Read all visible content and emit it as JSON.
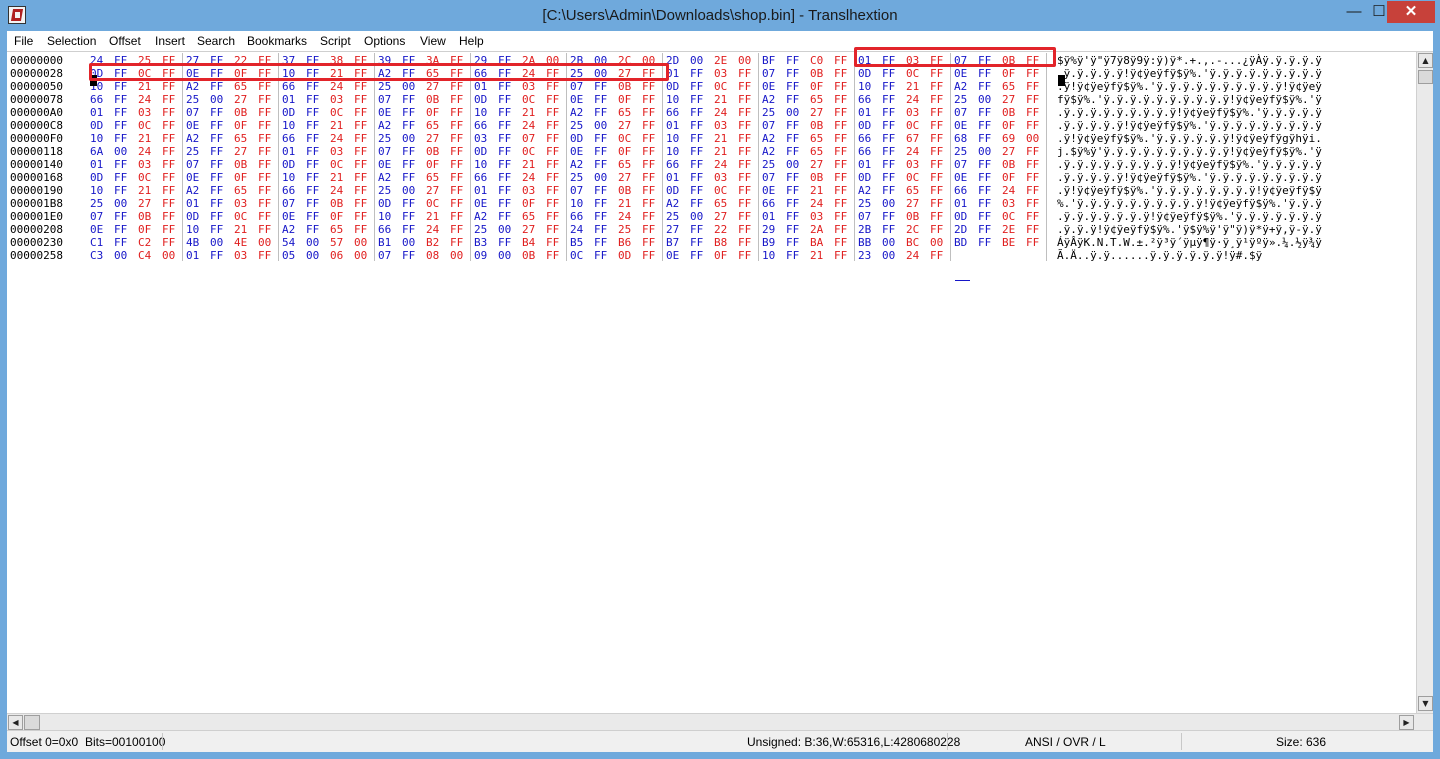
{
  "window": {
    "title": "[C:\\Users\\Admin\\Downloads\\shop.bin] - Translhextion",
    "min_glyph": "—",
    "max_glyph": "☐",
    "close_glyph": "✕"
  },
  "menu": [
    "File",
    "Selection",
    "Offset",
    "Insert",
    "Search",
    "Bookmarks",
    "Script",
    "Options",
    "View",
    "Help"
  ],
  "colors": {
    "red": "#e01e1e",
    "blue": "#1616c8",
    "highlight": "#e2242a"
  },
  "hex_rows": [
    {
      "offset": "00000000",
      "bytes": [
        "24",
        "FF",
        "25",
        "FF",
        "27",
        "FF",
        "22",
        "FF",
        "37",
        "FF",
        "38",
        "FF",
        "39",
        "FF",
        "3A",
        "FF",
        "29",
        "FF",
        "2A",
        "00",
        "2B",
        "00",
        "2C",
        "00",
        "2D",
        "00",
        "2E",
        "00",
        "BF",
        "FF",
        "C0",
        "FF",
        "01",
        "FF",
        "03",
        "FF",
        "07",
        "FF",
        "0B",
        "FF"
      ],
      "text": "$ÿ%ÿ'ÿ\"ÿ7ÿ8ÿ9ÿ:ÿ)ÿ*.+.,.-...¿ÿÀÿ.ÿ.ÿ.ÿ.ÿ"
    },
    {
      "offset": "00000028",
      "bytes": [
        "0D",
        "FF",
        "0C",
        "FF",
        "0E",
        "FF",
        "0F",
        "FF",
        "10",
        "FF",
        "21",
        "FF",
        "A2",
        "FF",
        "65",
        "FF",
        "66",
        "FF",
        "24",
        "FF",
        "25",
        "00",
        "27",
        "FF",
        "01",
        "FF",
        "03",
        "FF",
        "07",
        "FF",
        "0B",
        "FF",
        "0D",
        "FF",
        "0C",
        "FF",
        "0E",
        "FF",
        "0F",
        "FF"
      ],
      "text": ".ÿ.ÿ.ÿ.ÿ.ÿ!ÿ¢ÿeÿfÿ$ÿ%.'ÿ.ÿ.ÿ.ÿ.ÿ.ÿ.ÿ.ÿ.ÿ"
    },
    {
      "offset": "00000050",
      "bytes": [
        "10",
        "FF",
        "21",
        "FF",
        "A2",
        "FF",
        "65",
        "FF",
        "66",
        "FF",
        "24",
        "FF",
        "25",
        "00",
        "27",
        "FF",
        "01",
        "FF",
        "03",
        "FF",
        "07",
        "FF",
        "0B",
        "FF",
        "0D",
        "FF",
        "0C",
        "FF",
        "0E",
        "FF",
        "0F",
        "FF",
        "10",
        "FF",
        "21",
        "FF",
        "A2",
        "FF",
        "65",
        "FF"
      ],
      "text": ".ÿ!ÿ¢ÿeÿfÿ$ÿ%.'ÿ.ÿ.ÿ.ÿ.ÿ.ÿ.ÿ.ÿ.ÿ.ÿ!ÿ¢ÿeÿ"
    },
    {
      "offset": "00000078",
      "bytes": [
        "66",
        "FF",
        "24",
        "FF",
        "25",
        "00",
        "27",
        "FF",
        "01",
        "FF",
        "03",
        "FF",
        "07",
        "FF",
        "0B",
        "FF",
        "0D",
        "FF",
        "0C",
        "FF",
        "0E",
        "FF",
        "0F",
        "FF",
        "10",
        "FF",
        "21",
        "FF",
        "A2",
        "FF",
        "65",
        "FF",
        "66",
        "FF",
        "24",
        "FF",
        "25",
        "00",
        "27",
        "FF"
      ],
      "text": "fÿ$ÿ%.'ÿ.ÿ.ÿ.ÿ.ÿ.ÿ.ÿ.ÿ.ÿ.ÿ!ÿ¢ÿeÿfÿ$ÿ%.'ÿ"
    },
    {
      "offset": "000000A0",
      "bytes": [
        "01",
        "FF",
        "03",
        "FF",
        "07",
        "FF",
        "0B",
        "FF",
        "0D",
        "FF",
        "0C",
        "FF",
        "0E",
        "FF",
        "0F",
        "FF",
        "10",
        "FF",
        "21",
        "FF",
        "A2",
        "FF",
        "65",
        "FF",
        "66",
        "FF",
        "24",
        "FF",
        "25",
        "00",
        "27",
        "FF",
        "01",
        "FF",
        "03",
        "FF",
        "07",
        "FF",
        "0B",
        "FF"
      ],
      "text": ".ÿ.ÿ.ÿ.ÿ.ÿ.ÿ.ÿ.ÿ.ÿ!ÿ¢ÿeÿfÿ$ÿ%.'ÿ.ÿ.ÿ.ÿ.ÿ"
    },
    {
      "offset": "000000C8",
      "bytes": [
        "0D",
        "FF",
        "0C",
        "FF",
        "0E",
        "FF",
        "0F",
        "FF",
        "10",
        "FF",
        "21",
        "FF",
        "A2",
        "FF",
        "65",
        "FF",
        "66",
        "FF",
        "24",
        "FF",
        "25",
        "00",
        "27",
        "FF",
        "01",
        "FF",
        "03",
        "FF",
        "07",
        "FF",
        "0B",
        "FF",
        "0D",
        "FF",
        "0C",
        "FF",
        "0E",
        "FF",
        "0F",
        "FF"
      ],
      "text": ".ÿ.ÿ.ÿ.ÿ.ÿ!ÿ¢ÿeÿfÿ$ÿ%.'ÿ.ÿ.ÿ.ÿ.ÿ.ÿ.ÿ.ÿ.ÿ"
    },
    {
      "offset": "000000F0",
      "bytes": [
        "10",
        "FF",
        "21",
        "FF",
        "A2",
        "FF",
        "65",
        "FF",
        "66",
        "FF",
        "24",
        "FF",
        "25",
        "00",
        "27",
        "FF",
        "03",
        "FF",
        "07",
        "FF",
        "0D",
        "FF",
        "0C",
        "FF",
        "10",
        "FF",
        "21",
        "FF",
        "A2",
        "FF",
        "65",
        "FF",
        "66",
        "FF",
        "67",
        "FF",
        "68",
        "FF",
        "69",
        "00"
      ],
      "text": ".ÿ!ÿ¢ÿeÿfÿ$ÿ%.'ÿ.ÿ.ÿ.ÿ.ÿ.ÿ!ÿ¢ÿeÿfÿgÿhÿi."
    },
    {
      "offset": "00000118",
      "bytes": [
        "6A",
        "00",
        "24",
        "FF",
        "25",
        "FF",
        "27",
        "FF",
        "01",
        "FF",
        "03",
        "FF",
        "07",
        "FF",
        "0B",
        "FF",
        "0D",
        "FF",
        "0C",
        "FF",
        "0E",
        "FF",
        "0F",
        "FF",
        "10",
        "FF",
        "21",
        "FF",
        "A2",
        "FF",
        "65",
        "FF",
        "66",
        "FF",
        "24",
        "FF",
        "25",
        "00",
        "27",
        "FF"
      ],
      "text": "j.$ÿ%ÿ'ÿ.ÿ.ÿ.ÿ.ÿ.ÿ.ÿ.ÿ.ÿ.ÿ!ÿ¢ÿeÿfÿ$ÿ%.'ÿ"
    },
    {
      "offset": "00000140",
      "bytes": [
        "01",
        "FF",
        "03",
        "FF",
        "07",
        "FF",
        "0B",
        "FF",
        "0D",
        "FF",
        "0C",
        "FF",
        "0E",
        "FF",
        "0F",
        "FF",
        "10",
        "FF",
        "21",
        "FF",
        "A2",
        "FF",
        "65",
        "FF",
        "66",
        "FF",
        "24",
        "FF",
        "25",
        "00",
        "27",
        "FF",
        "01",
        "FF",
        "03",
        "FF",
        "07",
        "FF",
        "0B",
        "FF"
      ],
      "text": ".ÿ.ÿ.ÿ.ÿ.ÿ.ÿ.ÿ.ÿ.ÿ!ÿ¢ÿeÿfÿ$ÿ%.'ÿ.ÿ.ÿ.ÿ.ÿ"
    },
    {
      "offset": "00000168",
      "bytes": [
        "0D",
        "FF",
        "0C",
        "FF",
        "0E",
        "FF",
        "0F",
        "FF",
        "10",
        "FF",
        "21",
        "FF",
        "A2",
        "FF",
        "65",
        "FF",
        "66",
        "FF",
        "24",
        "FF",
        "25",
        "00",
        "27",
        "FF",
        "01",
        "FF",
        "03",
        "FF",
        "07",
        "FF",
        "0B",
        "FF",
        "0D",
        "FF",
        "0C",
        "FF",
        "0E",
        "FF",
        "0F",
        "FF"
      ],
      "text": ".ÿ.ÿ.ÿ.ÿ.ÿ!ÿ¢ÿeÿfÿ$ÿ%.'ÿ.ÿ.ÿ.ÿ.ÿ.ÿ.ÿ.ÿ.ÿ"
    },
    {
      "offset": "00000190",
      "bytes": [
        "10",
        "FF",
        "21",
        "FF",
        "A2",
        "FF",
        "65",
        "FF",
        "66",
        "FF",
        "24",
        "FF",
        "25",
        "00",
        "27",
        "FF",
        "01",
        "FF",
        "03",
        "FF",
        "07",
        "FF",
        "0B",
        "FF",
        "0D",
        "FF",
        "0C",
        "FF",
        "0E",
        "FF",
        "21",
        "FF",
        "A2",
        "FF",
        "65",
        "FF",
        "66",
        "FF",
        "24",
        "FF"
      ],
      "text": ".ÿ!ÿ¢ÿeÿfÿ$ÿ%.'ÿ.ÿ.ÿ.ÿ.ÿ.ÿ.ÿ.ÿ!ÿ¢ÿeÿfÿ$ÿ"
    },
    {
      "offset": "000001B8",
      "bytes": [
        "25",
        "00",
        "27",
        "FF",
        "01",
        "FF",
        "03",
        "FF",
        "07",
        "FF",
        "0B",
        "FF",
        "0D",
        "FF",
        "0C",
        "FF",
        "0E",
        "FF",
        "0F",
        "FF",
        "10",
        "FF",
        "21",
        "FF",
        "A2",
        "FF",
        "65",
        "FF",
        "66",
        "FF",
        "24",
        "FF",
        "25",
        "00",
        "27",
        "FF",
        "01",
        "FF",
        "03",
        "FF"
      ],
      "text": "%.'ÿ.ÿ.ÿ.ÿ.ÿ.ÿ.ÿ.ÿ.ÿ.ÿ!ÿ¢ÿeÿfÿ$ÿ%.'ÿ.ÿ.ÿ"
    },
    {
      "offset": "000001E0",
      "bytes": [
        "07",
        "FF",
        "0B",
        "FF",
        "0D",
        "FF",
        "0C",
        "FF",
        "0E",
        "FF",
        "0F",
        "FF",
        "10",
        "FF",
        "21",
        "FF",
        "A2",
        "FF",
        "65",
        "FF",
        "66",
        "FF",
        "24",
        "FF",
        "25",
        "00",
        "27",
        "FF",
        "01",
        "FF",
        "03",
        "FF",
        "07",
        "FF",
        "0B",
        "FF",
        "0D",
        "FF",
        "0C",
        "FF"
      ],
      "text": ".ÿ.ÿ.ÿ.ÿ.ÿ.ÿ.ÿ!ÿ¢ÿeÿfÿ$ÿ%.'ÿ.ÿ.ÿ.ÿ.ÿ.ÿ.ÿ"
    },
    {
      "offset": "00000208",
      "bytes": [
        "0E",
        "FF",
        "0F",
        "FF",
        "10",
        "FF",
        "21",
        "FF",
        "A2",
        "FF",
        "65",
        "FF",
        "66",
        "FF",
        "24",
        "FF",
        "25",
        "00",
        "27",
        "FF",
        "24",
        "FF",
        "25",
        "FF",
        "27",
        "FF",
        "22",
        "FF",
        "29",
        "FF",
        "2A",
        "FF",
        "2B",
        "FF",
        "2C",
        "FF",
        "2D",
        "FF",
        "2E",
        "FF"
      ],
      "text": ".ÿ.ÿ.ÿ!ÿ¢ÿeÿfÿ$ÿ%.'ÿ$ÿ%ÿ'ÿ\"ÿ)ÿ*ÿ+ÿ,ÿ-ÿ.ÿ"
    },
    {
      "offset": "00000230",
      "bytes": [
        "C1",
        "FF",
        "C2",
        "FF",
        "4B",
        "00",
        "4E",
        "00",
        "54",
        "00",
        "57",
        "00",
        "B1",
        "00",
        "B2",
        "FF",
        "B3",
        "FF",
        "B4",
        "FF",
        "B5",
        "FF",
        "B6",
        "FF",
        "B7",
        "FF",
        "B8",
        "FF",
        "B9",
        "FF",
        "BA",
        "FF",
        "BB",
        "00",
        "BC",
        "00",
        "BD",
        "FF",
        "BE",
        "FF"
      ],
      "text": "ÁÿÂÿK.N.T.W.±.²ÿ³ÿ´ÿµÿ¶ÿ·ÿ¸ÿ¹ÿºÿ».¼.½ÿ¾ÿ"
    },
    {
      "offset": "00000258",
      "bytes": [
        "C3",
        "00",
        "C4",
        "00",
        "01",
        "FF",
        "03",
        "FF",
        "05",
        "00",
        "06",
        "00",
        "07",
        "FF",
        "08",
        "00",
        "09",
        "00",
        "0B",
        "FF",
        "0C",
        "FF",
        "0D",
        "FF",
        "0E",
        "FF",
        "0F",
        "FF",
        "10",
        "FF",
        "21",
        "FF",
        "23",
        "00",
        "24",
        "FF"
      ],
      "text": "Ã.Ä..ÿ.ÿ......ÿ.ÿ.ÿ.ÿ.ÿ.ÿ!ÿ#.$ÿ"
    }
  ],
  "status": {
    "offset": "Offset 0=0x0",
    "bits": "Bits=00100100",
    "unsigned": "Unsigned: B:36,W:65316,L:4280680228",
    "mode": "ANSI / OVR / L",
    "size": "Size: 636"
  }
}
